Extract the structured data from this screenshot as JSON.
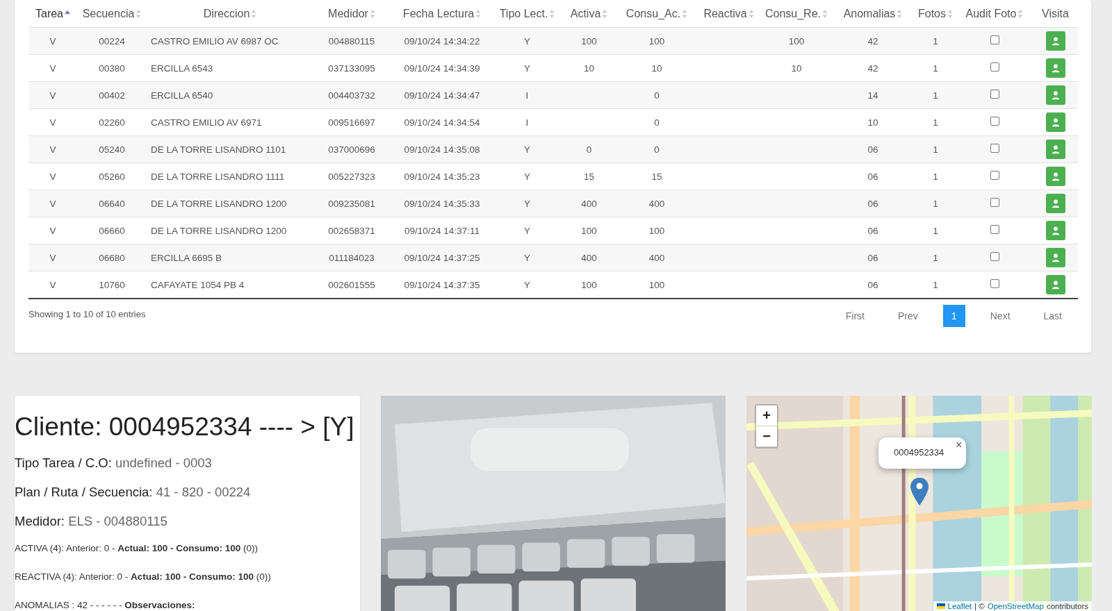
{
  "table": {
    "columns": [
      {
        "label": "Tarea",
        "sortable": true,
        "sorted": true
      },
      {
        "label": "Secuencia",
        "sortable": true,
        "sorted": false
      },
      {
        "label": "Direccion",
        "sortable": true,
        "sorted": false
      },
      {
        "label": "Medidor",
        "sortable": true,
        "sorted": false
      },
      {
        "label": "Fecha Lectura",
        "sortable": true,
        "sorted": false
      },
      {
        "label": "Tipo Lect.",
        "sortable": true,
        "sorted": false
      },
      {
        "label": "Activa",
        "sortable": true,
        "sorted": false
      },
      {
        "label": "Consu_Ac.",
        "sortable": true,
        "sorted": false
      },
      {
        "label": "Reactiva",
        "sortable": true,
        "sorted": false
      },
      {
        "label": "Consu_Re.",
        "sortable": true,
        "sorted": false
      },
      {
        "label": "Anomalias",
        "sortable": true,
        "sorted": false
      },
      {
        "label": "Fotos",
        "sortable": true,
        "sorted": false
      },
      {
        "label": "Audit Foto",
        "sortable": true,
        "sorted": false
      },
      {
        "label": "Visita"
      }
    ],
    "rows": [
      {
        "cells": [
          "V",
          "00224",
          "CASTRO EMILIO AV 6987 OC",
          "004880115",
          "09/10/24 14:34:22",
          "Y",
          "100",
          "100",
          "",
          "100",
          "42",
          "1"
        ],
        "audit_checked": false
      },
      {
        "cells": [
          "V",
          "00380",
          "ERCILLA 6543",
          "037133095",
          "09/10/24 14:34:39",
          "Y",
          "10",
          "10",
          "",
          "10",
          "42",
          "1"
        ],
        "audit_checked": false
      },
      {
        "cells": [
          "V",
          "00402",
          "ERCILLA 6540",
          "004403732",
          "09/10/24 14:34:47",
          "I",
          "",
          "0",
          "",
          "",
          "14",
          "1"
        ],
        "audit_checked": false
      },
      {
        "cells": [
          "V",
          "02260",
          "CASTRO EMILIO AV 6971",
          "009516697",
          "09/10/24 14:34:54",
          "I",
          "",
          "0",
          "",
          "",
          "10",
          "1"
        ],
        "audit_checked": false
      },
      {
        "cells": [
          "V",
          "05240",
          "DE LA TORRE LISANDRO 1101",
          "037000696",
          "09/10/24 14:35:08",
          "Y",
          "0",
          "0",
          "",
          "",
          "06",
          "1"
        ],
        "audit_checked": false
      },
      {
        "cells": [
          "V",
          "05260",
          "DE LA TORRE LISANDRO 1111",
          "005227323",
          "09/10/24 14:35:23",
          "Y",
          "15",
          "15",
          "",
          "",
          "06",
          "1"
        ],
        "audit_checked": false
      },
      {
        "cells": [
          "V",
          "06640",
          "DE LA TORRE LISANDRO 1200",
          "009235081",
          "09/10/24 14:35:33",
          "Y",
          "400",
          "400",
          "",
          "",
          "06",
          "1"
        ],
        "audit_checked": false
      },
      {
        "cells": [
          "V",
          "06660",
          "DE LA TORRE LISANDRO 1200",
          "002658371",
          "09/10/24 14:37:11",
          "Y",
          "100",
          "100",
          "",
          "",
          "06",
          "1"
        ],
        "audit_checked": false
      },
      {
        "cells": [
          "V",
          "06680",
          "ERCILLA 6695 B",
          "011184023",
          "09/10/24 14:37:25",
          "Y",
          "400",
          "400",
          "",
          "",
          "06",
          "1"
        ],
        "audit_checked": false
      },
      {
        "cells": [
          "V",
          "10760",
          "CAFAYATE 1054 PB 4",
          "002601555",
          "09/10/24 14:37:35",
          "Y",
          "100",
          "100",
          "",
          "",
          "06",
          "1"
        ],
        "audit_checked": false
      }
    ]
  },
  "footer": {
    "info": "Showing 1 to 10 of 10 entries",
    "pagination": [
      {
        "label": "First",
        "selected": false
      },
      {
        "label": "Prev",
        "selected": false
      },
      {
        "label": "1",
        "selected": true
      },
      {
        "label": "Next",
        "selected": false
      },
      {
        "label": "Last",
        "selected": false
      }
    ]
  },
  "client": {
    "title": "Cliente: 0004952334 ---- > [Y]",
    "fields": [
      {
        "label": "Tipo Tarea / C.O:",
        "value": "undefined - 0003"
      },
      {
        "label": "Plan / Ruta / Secuencia:",
        "value": "41 - 820 - 00224"
      },
      {
        "label": "Medidor:",
        "value": "ELS - 004880115"
      }
    ],
    "lines": [
      "ACTIVA (4): Anterior: 0 - **Actual: 100 - Consumo: 100** (0))",
      "REACTIVA (4): Anterior: 0 - **Actual: 100 - Consumo: 100** (0))",
      "ANOMALIAS : 42 - - - - - - **Observaciones:**"
    ]
  },
  "map": {
    "zoom_in": "+",
    "zoom_out": "−",
    "popup": {
      "text": "0004952334",
      "close": "×"
    },
    "attribution": {
      "link_1": "Leaflet",
      "separator": "| ©",
      "link_2": "OpenStreetMap",
      "suffix": "contributors"
    }
  }
}
